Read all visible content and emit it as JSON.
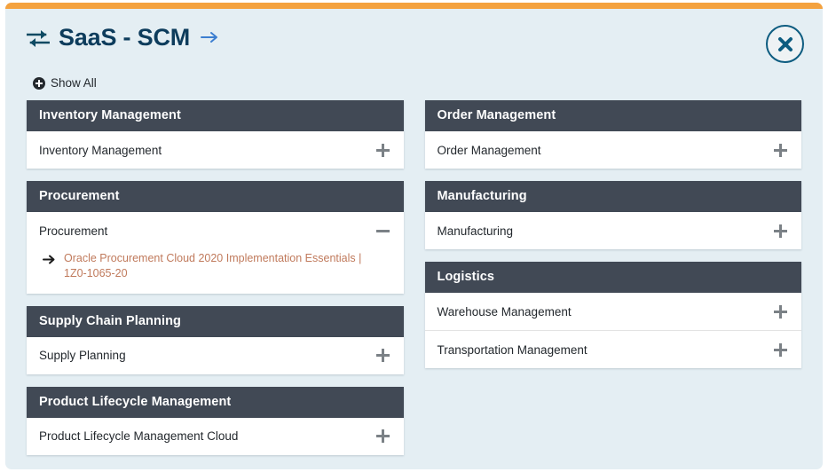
{
  "header": {
    "title": "SaaS - SCM",
    "swap_icon": "exchange-arrows-icon",
    "title_arrow_icon": "arrow-right-icon",
    "show_all_label": "Show All",
    "close_label": "close",
    "accent_color": "#f4a23f",
    "title_color": "#0d3c5c",
    "panel_header_color": "#414955",
    "link_color": "#c07a5c",
    "background_color": "#e4eef3"
  },
  "columns": [
    {
      "panels": [
        {
          "title": "Inventory Management",
          "rows": [
            {
              "label": "Inventory Management",
              "state": "collapsed",
              "toggle": "plus"
            }
          ]
        },
        {
          "title": "Procurement",
          "rows": [
            {
              "label": "Procurement",
              "state": "expanded",
              "toggle": "minus",
              "children": [
                {
                  "label": "Oracle Procurement Cloud 2020 Implementation Essentials | 1Z0-1065-20"
                }
              ]
            }
          ]
        },
        {
          "title": "Supply Chain Planning",
          "rows": [
            {
              "label": "Supply Planning",
              "state": "collapsed",
              "toggle": "plus"
            }
          ]
        },
        {
          "title": "Product Lifecycle Management",
          "rows": [
            {
              "label": "Product Lifecycle Management Cloud",
              "state": "collapsed",
              "toggle": "plus"
            }
          ]
        }
      ]
    },
    {
      "panels": [
        {
          "title": "Order Management",
          "rows": [
            {
              "label": "Order Management",
              "state": "collapsed",
              "toggle": "plus"
            }
          ]
        },
        {
          "title": "Manufacturing",
          "rows": [
            {
              "label": "Manufacturing",
              "state": "collapsed",
              "toggle": "plus"
            }
          ]
        },
        {
          "title": "Logistics",
          "rows": [
            {
              "label": "Warehouse Management",
              "state": "collapsed",
              "toggle": "plus"
            },
            {
              "label": "Transportation Management",
              "state": "collapsed",
              "toggle": "plus"
            }
          ]
        }
      ]
    }
  ]
}
